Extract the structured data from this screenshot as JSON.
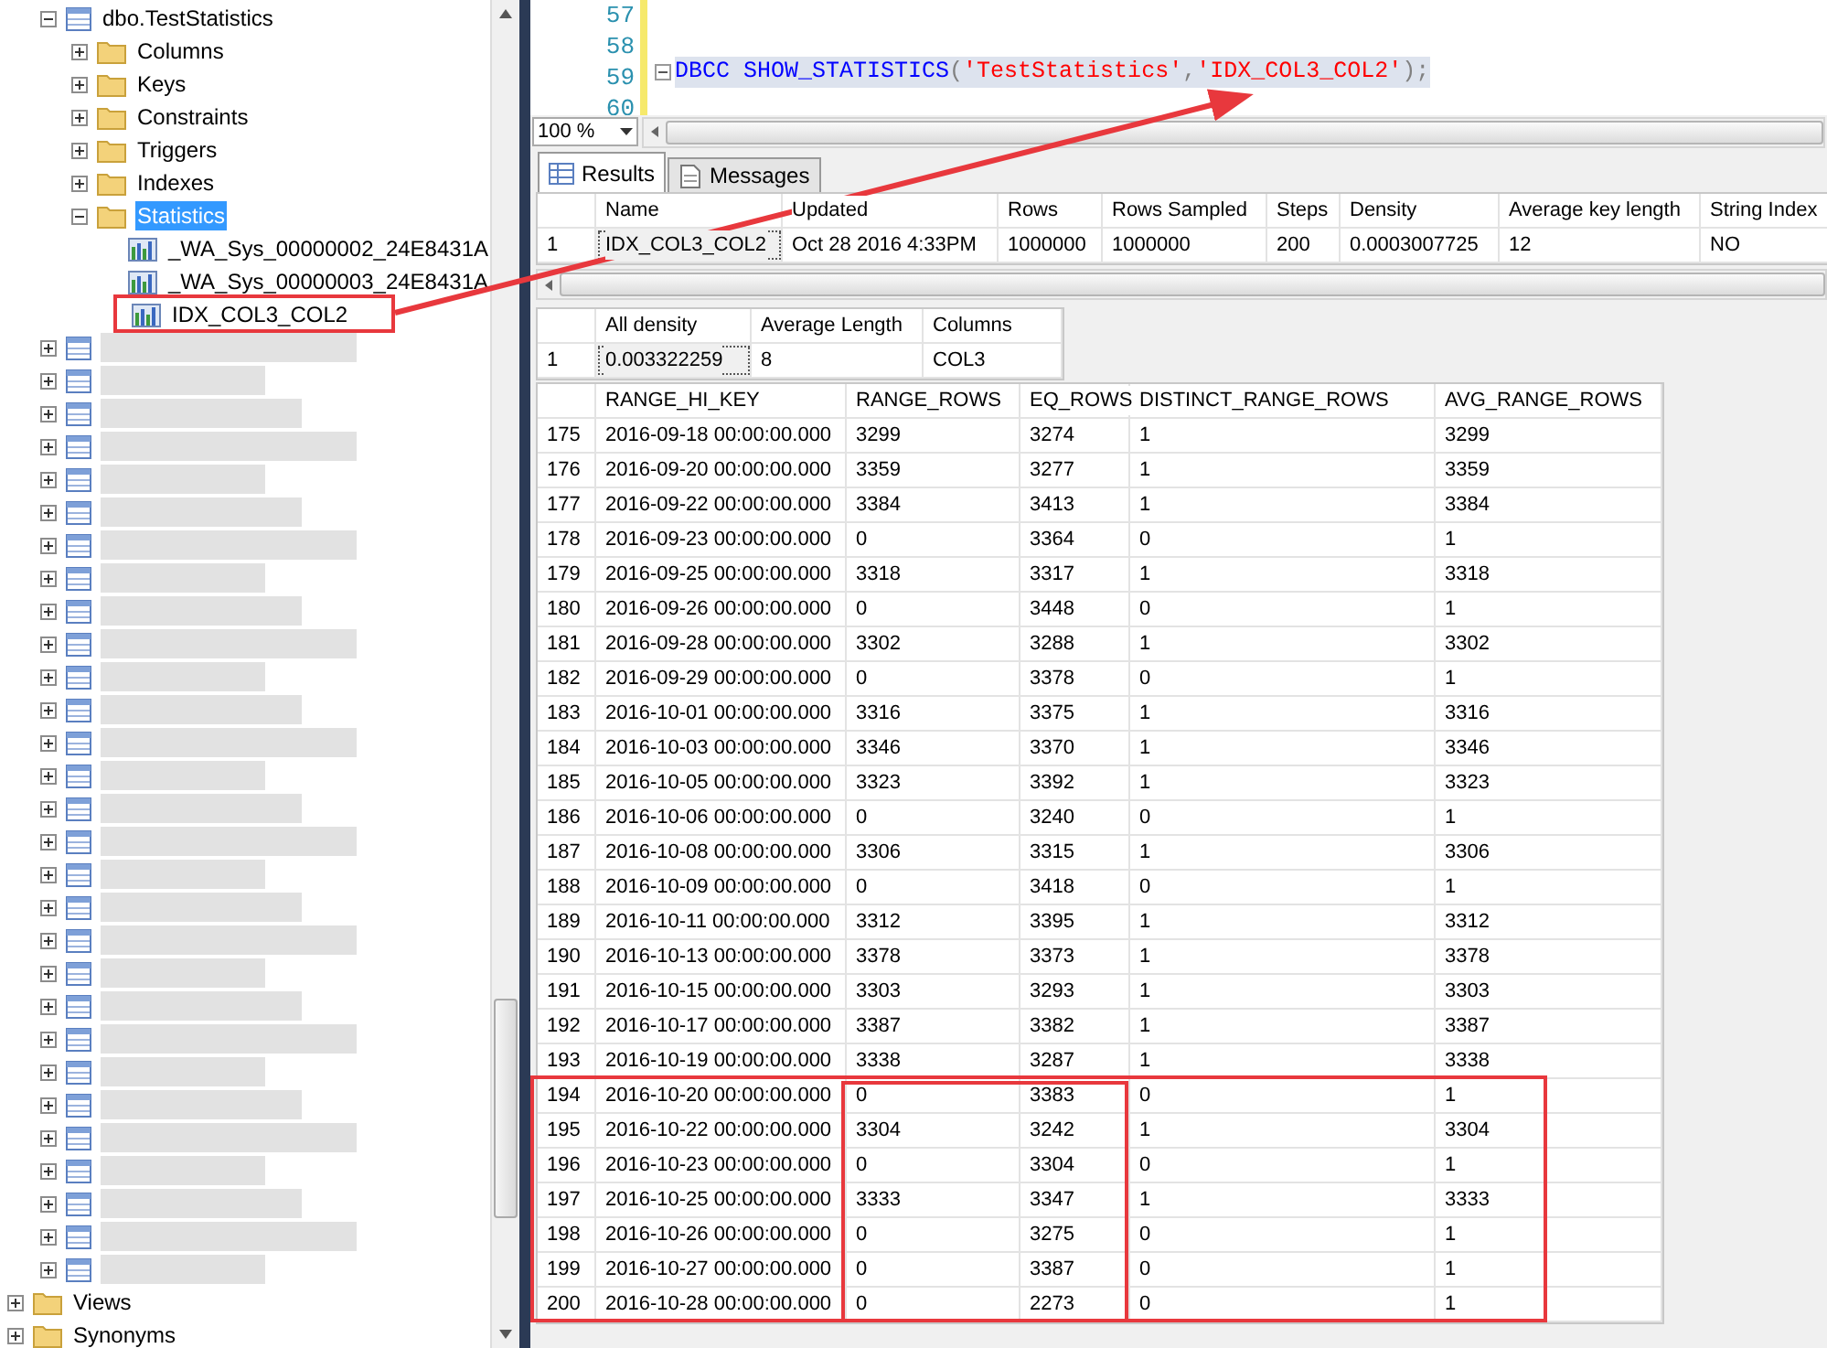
{
  "object_explorer": {
    "table": {
      "label": "dbo.TestStatistics",
      "expanded": true,
      "selected": false,
      "children": [
        {
          "label": "Columns",
          "expanded": false,
          "selected": false
        },
        {
          "label": "Keys",
          "expanded": false,
          "selected": false
        },
        {
          "label": "Constraints",
          "expanded": false,
          "selected": false
        },
        {
          "label": "Triggers",
          "expanded": false,
          "selected": false
        },
        {
          "label": "Indexes",
          "expanded": false,
          "selected": false
        },
        {
          "label": "Statistics",
          "expanded": true,
          "selected": true,
          "children": [
            {
              "label": "_WA_Sys_00000002_24E8431A",
              "selected": false
            },
            {
              "label": "_WA_Sys_00000003_24E8431A",
              "selected": false
            },
            {
              "label": "IDX_COL3_COL2",
              "selected": false
            }
          ]
        }
      ]
    },
    "redacted_tables": [
      {
        "expanded": false
      },
      {
        "expanded": false
      },
      {
        "expanded": false
      },
      {
        "expanded": false
      },
      {
        "expanded": false
      },
      {
        "expanded": false
      },
      {
        "expanded": false
      },
      {
        "expanded": false
      },
      {
        "expanded": false
      },
      {
        "expanded": false
      },
      {
        "expanded": false
      },
      {
        "expanded": false
      },
      {
        "expanded": false
      },
      {
        "expanded": false
      },
      {
        "expanded": false
      },
      {
        "expanded": false
      },
      {
        "expanded": false
      },
      {
        "expanded": false
      },
      {
        "expanded": false
      },
      {
        "expanded": false
      },
      {
        "expanded": false
      },
      {
        "expanded": false
      },
      {
        "expanded": false
      },
      {
        "expanded": false
      },
      {
        "expanded": false
      },
      {
        "expanded": false
      },
      {
        "expanded": false
      },
      {
        "expanded": false
      },
      {
        "expanded": false
      }
    ],
    "folders": [
      {
        "label": "Views",
        "expanded": false,
        "selected": false
      },
      {
        "label": "Synonyms",
        "expanded": false,
        "selected": false
      }
    ]
  },
  "editor": {
    "lines": [
      {
        "number": "57"
      },
      {
        "number": "58"
      },
      {
        "number": "59",
        "tokens": [
          {
            "kind": "keyword",
            "text": "DBCC SHOW_STATISTICS"
          },
          {
            "kind": "punct",
            "text": "("
          },
          {
            "kind": "string",
            "text": "'TestStatistics'"
          },
          {
            "kind": "punct",
            "text": ","
          },
          {
            "kind": "string",
            "text": "'IDX_COL3_COL2'"
          },
          {
            "kind": "punct",
            "text": ");"
          }
        ]
      },
      {
        "number": "60"
      }
    ],
    "zoom": "100 %"
  },
  "result_tabs": [
    {
      "label": "Results",
      "selected": true
    },
    {
      "label": "Messages",
      "selected": false
    }
  ],
  "header_grid": {
    "columns": [
      "Name",
      "Updated",
      "Rows",
      "Rows Sampled",
      "Steps",
      "Density",
      "Average key length",
      "String Index"
    ],
    "rows": [
      {
        "number": "1",
        "cells": [
          "IDX_COL3_COL2",
          "Oct 28 2016  4:33PM",
          "1000000",
          "1000000",
          "200",
          "0.0003007725",
          "12",
          "NO"
        ]
      }
    ]
  },
  "density_grid": {
    "columns": [
      "All density",
      "Average Length",
      "Columns"
    ],
    "rows": [
      {
        "number": "1",
        "cells": [
          "0.003322259",
          "8",
          "COL3"
        ]
      }
    ]
  },
  "histogram_grid": {
    "columns": [
      "RANGE_HI_KEY",
      "RANGE_ROWS",
      "EQ_ROWS",
      "DISTINCT_RANGE_ROWS",
      "AVG_RANGE_ROWS"
    ],
    "rows": [
      {
        "number": "175",
        "cells": [
          "2016-09-18 00:00:00.000",
          "3299",
          "3274",
          "1",
          "3299"
        ]
      },
      {
        "number": "176",
        "cells": [
          "2016-09-20 00:00:00.000",
          "3359",
          "3277",
          "1",
          "3359"
        ]
      },
      {
        "number": "177",
        "cells": [
          "2016-09-22 00:00:00.000",
          "3384",
          "3413",
          "1",
          "3384"
        ]
      },
      {
        "number": "178",
        "cells": [
          "2016-09-23 00:00:00.000",
          "0",
          "3364",
          "0",
          "1"
        ]
      },
      {
        "number": "179",
        "cells": [
          "2016-09-25 00:00:00.000",
          "3318",
          "3317",
          "1",
          "3318"
        ]
      },
      {
        "number": "180",
        "cells": [
          "2016-09-26 00:00:00.000",
          "0",
          "3448",
          "0",
          "1"
        ]
      },
      {
        "number": "181",
        "cells": [
          "2016-09-28 00:00:00.000",
          "3302",
          "3288",
          "1",
          "3302"
        ]
      },
      {
        "number": "182",
        "cells": [
          "2016-09-29 00:00:00.000",
          "0",
          "3378",
          "0",
          "1"
        ]
      },
      {
        "number": "183",
        "cells": [
          "2016-10-01 00:00:00.000",
          "3316",
          "3375",
          "1",
          "3316"
        ]
      },
      {
        "number": "184",
        "cells": [
          "2016-10-03 00:00:00.000",
          "3346",
          "3370",
          "1",
          "3346"
        ]
      },
      {
        "number": "185",
        "cells": [
          "2016-10-05 00:00:00.000",
          "3323",
          "3392",
          "1",
          "3323"
        ]
      },
      {
        "number": "186",
        "cells": [
          "2016-10-06 00:00:00.000",
          "0",
          "3240",
          "0",
          "1"
        ]
      },
      {
        "number": "187",
        "cells": [
          "2016-10-08 00:00:00.000",
          "3306",
          "3315",
          "1",
          "3306"
        ]
      },
      {
        "number": "188",
        "cells": [
          "2016-10-09 00:00:00.000",
          "0",
          "3418",
          "0",
          "1"
        ]
      },
      {
        "number": "189",
        "cells": [
          "2016-10-11 00:00:00.000",
          "3312",
          "3395",
          "1",
          "3312"
        ]
      },
      {
        "number": "190",
        "cells": [
          "2016-10-13 00:00:00.000",
          "3378",
          "3373",
          "1",
          "3378"
        ]
      },
      {
        "number": "191",
        "cells": [
          "2016-10-15 00:00:00.000",
          "3303",
          "3293",
          "1",
          "3303"
        ]
      },
      {
        "number": "192",
        "cells": [
          "2016-10-17 00:00:00.000",
          "3387",
          "3382",
          "1",
          "3387"
        ]
      },
      {
        "number": "193",
        "cells": [
          "2016-10-19 00:00:00.000",
          "3338",
          "3287",
          "1",
          "3338"
        ]
      },
      {
        "number": "194",
        "cells": [
          "2016-10-20 00:00:00.000",
          "0",
          "3383",
          "0",
          "1"
        ]
      },
      {
        "number": "195",
        "cells": [
          "2016-10-22 00:00:00.000",
          "3304",
          "3242",
          "1",
          "3304"
        ]
      },
      {
        "number": "196",
        "cells": [
          "2016-10-23 00:00:00.000",
          "0",
          "3304",
          "0",
          "1"
        ]
      },
      {
        "number": "197",
        "cells": [
          "2016-10-25 00:00:00.000",
          "3333",
          "3347",
          "1",
          "3333"
        ]
      },
      {
        "number": "198",
        "cells": [
          "2016-10-26 00:00:00.000",
          "0",
          "3275",
          "0",
          "1"
        ]
      },
      {
        "number": "199",
        "cells": [
          "2016-10-27 00:00:00.000",
          "0",
          "3387",
          "0",
          "1"
        ]
      },
      {
        "number": "200",
        "cells": [
          "2016-10-28 00:00:00.000",
          "0",
          "2273",
          "0",
          "1"
        ]
      }
    ]
  }
}
